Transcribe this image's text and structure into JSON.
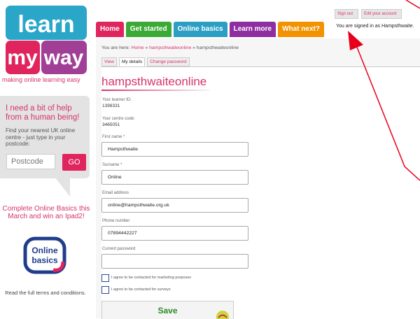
{
  "brand": {
    "logo_line1": "learn",
    "logo_line2_a": "my",
    "logo_line2_b": "way",
    "tagline": "making online learning easy",
    "colors": {
      "teal": "#29a6c8",
      "purple": "#a13f97",
      "pink": "#d6336c"
    }
  },
  "help": {
    "title": "I need a bit of help from a human being!",
    "text": "Find your nearest UK online centre - just type in your postcode:",
    "postcode_placeholder": "Postcode",
    "go_label": "GO"
  },
  "promo": {
    "text": "Complete Online Basics this March and win an Ipad2!",
    "badge_line1": "Online",
    "badge_line2": "basics",
    "terms": "Read the full terms and conditions."
  },
  "nav": {
    "tabs": [
      {
        "label": "Home",
        "color": "#e0245e"
      },
      {
        "label": "Get started",
        "color": "#3aa935"
      },
      {
        "label": "Online basics",
        "color": "#2b9fc3"
      },
      {
        "label": "Learn more",
        "color": "#8e2ea0"
      },
      {
        "label": "What next?",
        "color": "#f39200"
      }
    ]
  },
  "account": {
    "sign_out": "Sign out",
    "edit_account": "Edit your account",
    "signed_in_text": "You are signed in as Hampsthwaite."
  },
  "breadcrumb": {
    "prefix": "You are here:",
    "home": "Home",
    "sep": "»",
    "user_link": "hampsthwaiteonline",
    "current": "hampsthwaiteonline"
  },
  "subtabs": [
    {
      "label": "View",
      "active": false
    },
    {
      "label": "My details",
      "active": true
    },
    {
      "label": "Change password",
      "active": false
    }
  ],
  "profile": {
    "username": "hampsthwaiteonline",
    "learner_id_label": "Your learner ID:",
    "learner_id": "1398331",
    "centre_code_label": "Your centre code:",
    "centre_code": "3465051",
    "first_name_label": "First name",
    "first_name": "Hampsthwaite",
    "surname_label": "Surname",
    "surname": "Online",
    "email_label": "Email address",
    "email": "online@hampsthwaite.org.uk",
    "phone_label": "Phone number",
    "phone": "07894442227",
    "password_label": "Current password",
    "password": "",
    "marketing_label": "I agree to be contacted for marketing purposes",
    "surveys_label": "I agree to be contacted for surveys",
    "save_label": "Save"
  }
}
